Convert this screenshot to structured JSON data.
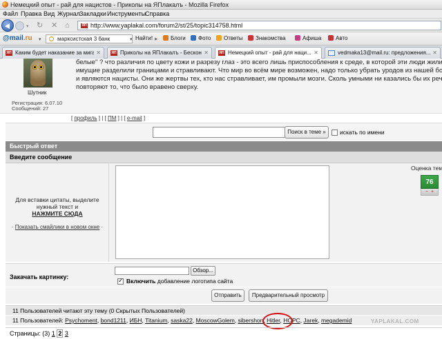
{
  "window": {
    "title": "Немецкий опыт - рай для нацистов - Приколы на ЯПлакалъ - Mozilla Firefox"
  },
  "menu": [
    "Файл",
    "Правка",
    "Вид",
    "Журнал",
    "Закладки",
    "Инструменты",
    "Справка"
  ],
  "nav": {
    "url": "http://www.yaplakal.com/forum2/st/25/topic314758.html",
    "favicon": "ЯП"
  },
  "mailru": {
    "logo_prefix": "@",
    "logo_text": "mail",
    "logo_suffix": ".ru",
    "search_value": "марксистская 3 банк",
    "find_label": "Найти!",
    "items": [
      {
        "label": "Блоги",
        "icon": "blog-icon",
        "color": "#e07a1a"
      },
      {
        "label": "Фото",
        "icon": "photo-icon",
        "color": "#2f6fbf"
      },
      {
        "label": "Ответы",
        "icon": "answers-icon",
        "color": "#f2a21b"
      },
      {
        "label": "Знакомства",
        "icon": "hearts-icon",
        "color": "#d52f2f"
      },
      {
        "label": "Афиша",
        "icon": "poster-icon",
        "color": "#c63b86"
      },
      {
        "label": "Авто",
        "icon": "car-icon",
        "color": "#c73333"
      }
    ]
  },
  "tabs": [
    {
      "label": "Каким будет наказание за мигалки",
      "icon": "ЯП"
    },
    {
      "label": "Приколы на ЯПлакалъ - Бесконеч...",
      "icon": "ЯП"
    },
    {
      "label": "Немецкий опыт - рай для наци...",
      "icon": "ЯП",
      "active": true
    },
    {
      "label": "vedmaka13@mail.ru: предложения...",
      "icon": "mail"
    }
  ],
  "post": {
    "username": "Шутник",
    "registration": "Регистрация: 6.07.10",
    "messages": "Сообщений: 27",
    "lines": [
      "белые\" ? что различия по цвету кожи и разрезу глаз - это всего лишь приспособления к среде, в которой эти люди жили веками.",
      "имущие разделили границами и стравливают. Что мир во всём мире возможен, надо только убрать уродов из нашей большой семьи",
      "и являются нацисты. Они же жертвы тех, кто нас стравливает, им промыли мозги. Сколь умными ни казались бы их речи, но они",
      "повторяют то, что было вравено сверху."
    ],
    "links": {
      "profile": "профиль",
      "pm": "ПМ",
      "email": "e-mail"
    }
  },
  "search": {
    "button": "Поиск в теме »",
    "by_name": "искать по имени"
  },
  "quick_reply": {
    "header": "Быстрый ответ",
    "enter_message": "Введите сообщение",
    "hint_line1": "Для вставки цитаты, выделите",
    "hint_line2": "нужный текст и",
    "hint_action": "НАЖМИТЕ СЮДА",
    "smiles_link": "Показать смайлики в новом окне",
    "rating_label": "Оценка темы",
    "rating_value": "76",
    "upload_label": "Закачать картинку:",
    "browse_button": "Обзор...",
    "logo_strong": "Включить",
    "logo_rest": " добавление логотипа сайта",
    "send_button": "Отправить",
    "preview_button": "Предварительный просмотр"
  },
  "readers": {
    "reading": "11 Пользователей читают эту тему (0 Скрытых Пользователей)",
    "users_prefix": "11 Пользователей:",
    "users": [
      "Psychoment",
      "bond1211",
      "ИБН",
      "Titanium",
      "saska22",
      "MoscowGolem",
      "sibershon",
      "Hitler",
      "НОРС",
      "Jarek",
      "megademid"
    ]
  },
  "watermark": "YAPLAKAL.COM",
  "pagination": {
    "label": "Страницы:",
    "total": "(3)",
    "pages": [
      "1",
      "2",
      "3"
    ],
    "current": "2"
  }
}
